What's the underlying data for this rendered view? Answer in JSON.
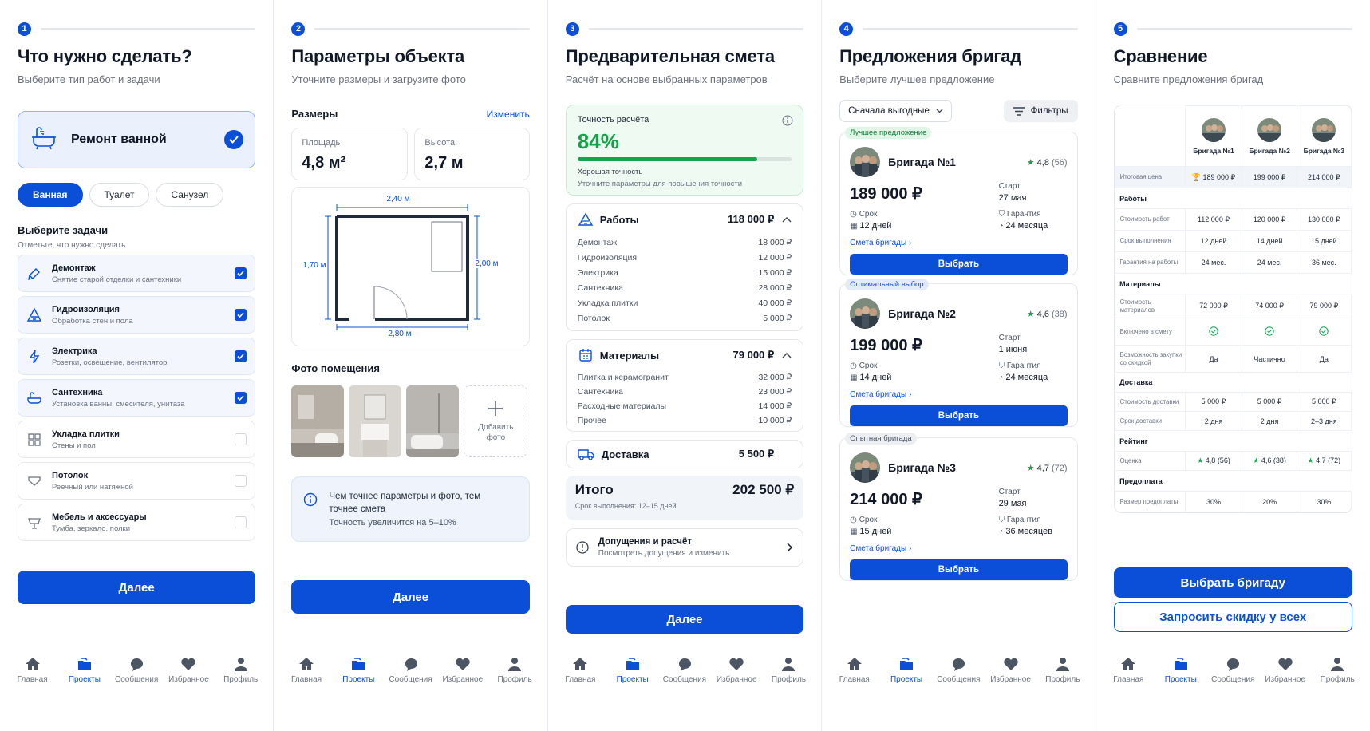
{
  "steps": [
    {
      "num": "1",
      "title": "Что нужно сделать?",
      "subtitle": "Выберите тип работ и задачи"
    },
    {
      "num": "2",
      "title": "Параметры объекта",
      "subtitle": "Уточните размеры и загрузите фото"
    },
    {
      "num": "3",
      "title": "Предварительная смета",
      "subtitle": "Расчёт на основе выбранных параметров"
    },
    {
      "num": "4",
      "title": "Предложения бригад",
      "subtitle": "Выберите лучшее предложение"
    },
    {
      "num": "5",
      "title": "Сравнение",
      "subtitle": "Сравните предложения бригад"
    }
  ],
  "p1": {
    "service": "Ремонт ванной",
    "pills": [
      "Ванная",
      "Туалет",
      "Санузел"
    ],
    "tasks_title": "Выберите задачи",
    "tasks_sub": "Отметьте, что нужно сделать",
    "tasks": [
      {
        "title": "Демонтаж",
        "sub": "Снятие старой отделки и сантехники",
        "checked": true,
        "icon": "demolition-icon"
      },
      {
        "title": "Гидроизоляция",
        "sub": "Обработка стен и пола",
        "checked": true,
        "icon": "waterproofing-icon"
      },
      {
        "title": "Электрика",
        "sub": "Розетки, освещение, вентилятор",
        "checked": true,
        "icon": "electric-icon"
      },
      {
        "title": "Сантехника",
        "sub": "Установка ванны, смесителя, унитаза",
        "checked": true,
        "icon": "bathtub-icon"
      },
      {
        "title": "Укладка плитки",
        "sub": "Стены и пол",
        "checked": false,
        "icon": "tile-icon"
      },
      {
        "title": "Потолок",
        "sub": "Реечный или натяжной",
        "checked": false,
        "icon": "ceiling-icon"
      },
      {
        "title": "Мебель и аксессуары",
        "sub": "Тумба, зеркало, полки",
        "checked": false,
        "icon": "furniture-icon"
      }
    ],
    "next": "Далее"
  },
  "p2": {
    "sizes_title": "Размеры",
    "edit": "Изменить",
    "area_label": "Площадь",
    "area_value": "4,8 м²",
    "height_label": "Высота",
    "height_value": "2,7 м",
    "dim_top": "2,40 м",
    "dim_left": "1,70 м",
    "dim_right": "2,00 м",
    "dim_bottom": "2,80 м",
    "photos_title": "Фото помещения",
    "add_photo": "Добавить фото",
    "info_text": "Чем точнее параметры и фото, тем точнее смета",
    "info_sub": "Точность увеличится на 5–10%",
    "next": "Далее"
  },
  "p3": {
    "accuracy_label": "Точность расчёта",
    "accuracy_value": "84%",
    "accuracy_fraction": 0.84,
    "accuracy_s1": "Хорошая точность",
    "accuracy_s2": "Уточните параметры для повышения точности",
    "works": {
      "name": "Работы",
      "total": "118 000 ₽",
      "rows": [
        [
          "Демонтаж",
          "18 000 ₽"
        ],
        [
          "Гидроизоляция",
          "12 000 ₽"
        ],
        [
          "Электрика",
          "15 000 ₽"
        ],
        [
          "Сантехника",
          "28 000 ₽"
        ],
        [
          "Укладка плитки",
          "40 000 ₽"
        ],
        [
          "Потолок",
          "5 000 ₽"
        ]
      ]
    },
    "materials": {
      "name": "Материалы",
      "total": "79 000 ₽",
      "rows": [
        [
          "Плитка и керамогранит",
          "32 000 ₽"
        ],
        [
          "Сантехника",
          "23 000 ₽"
        ],
        [
          "Расходные материалы",
          "14 000 ₽"
        ],
        [
          "Прочее",
          "10 000 ₽"
        ]
      ]
    },
    "delivery_name": "Доставка",
    "delivery_value": "5 500 ₽",
    "total_label": "Итого",
    "total_value": "202 500 ₽",
    "total_sub": "Срок выполнения: 12–15 дней",
    "assump_title": "Допущения и расчёт",
    "assump_sub": "Посмотреть допущения и изменить",
    "next": "Далее"
  },
  "p4": {
    "sort": "Сначала выгодные",
    "filters": "Фильтры",
    "offers": [
      {
        "badge": "Лучшее предложение",
        "badge_color": "#dff5e6",
        "badge_text_color": "#15803d",
        "name": "Бригада №1",
        "rating": "4,8",
        "count": "(56)",
        "price": "189 000 ₽",
        "start_label": "Старт",
        "start": "27 мая",
        "term_label": "Срок",
        "term": "12 дней",
        "warranty_label": "Гарантия",
        "warranty": "24 месяца",
        "link": "Смета бригады",
        "btn": "Выбрать"
      },
      {
        "badge": "Оптимальный выбор",
        "badge_color": "#e3ebfb",
        "badge_text_color": "#1d4ed8",
        "name": "Бригада №2",
        "rating": "4,6",
        "count": "(38)",
        "price": "199 000 ₽",
        "start_label": "Старт",
        "start": "1 июня",
        "term_label": "Срок",
        "term": "14 дней",
        "warranty_label": "Гарантия",
        "warranty": "24 месяца",
        "link": "Смета бригады",
        "btn": "Выбрать"
      },
      {
        "badge": "Опытная бригада",
        "badge_color": "#eceef2",
        "badge_text_color": "#4b5563",
        "name": "Бригада №3",
        "rating": "4,7",
        "count": "(72)",
        "price": "214 000 ₽",
        "start_label": "Старт",
        "start": "29 мая",
        "term_label": "Срок",
        "term": "15 дней",
        "warranty_label": "Гарантия",
        "warranty": "36 месяцев",
        "link": "Смета бригады",
        "btn": "Выбрать"
      }
    ]
  },
  "p5": {
    "teams": [
      "Бригада №1",
      "Бригада №2",
      "Бригада №3"
    ],
    "total_label": "Итоговая цена",
    "total_vals": [
      "189 000 ₽",
      "199 000 ₽",
      "214 000 ₽"
    ],
    "sec_works": "Работы",
    "works_rows": [
      [
        "Стоимость работ",
        "112 000 ₽",
        "120 000 ₽",
        "130 000 ₽"
      ],
      [
        "Срок выполнения",
        "12 дней",
        "14 дней",
        "15 дней"
      ],
      [
        "Гарантия на работы",
        "24 мес.",
        "24 мес.",
        "36 мес."
      ]
    ],
    "sec_materials": "Материалы",
    "mat_cost": [
      "Стоимость материалов",
      "72 000 ₽",
      "74 000 ₽",
      "79 000 ₽"
    ],
    "mat_included": "Включено в смету",
    "mat_discount": [
      "Возможность закупки со скидкой",
      "Да",
      "Частично",
      "Да"
    ],
    "sec_delivery": "Доставка",
    "delivery_rows": [
      [
        "Стоимость доставки",
        "5 000 ₽",
        "5 000 ₽",
        "5 000 ₽"
      ],
      [
        "Срок доставки",
        "2 дня",
        "2 дня",
        "2–3 дня"
      ]
    ],
    "sec_rating": "Рейтинг",
    "rating_label": "Оценка",
    "ratings": [
      [
        "4,8",
        "(56)"
      ],
      [
        "4,6",
        "(38)"
      ],
      [
        "4,7",
        "(72)"
      ]
    ],
    "sec_prepay": "Предоплата",
    "prepay": [
      "Размер предоплаты",
      "30%",
      "20%",
      "30%"
    ],
    "btn_choose": "Выбрать бригаду",
    "btn_discount": "Запросить скидку у всех"
  },
  "nav": [
    "Главная",
    "Проекты",
    "Сообщения",
    "Избранное",
    "Профиль"
  ],
  "colors": {
    "accent": "#0b4fd8",
    "success": "#15a34a"
  }
}
